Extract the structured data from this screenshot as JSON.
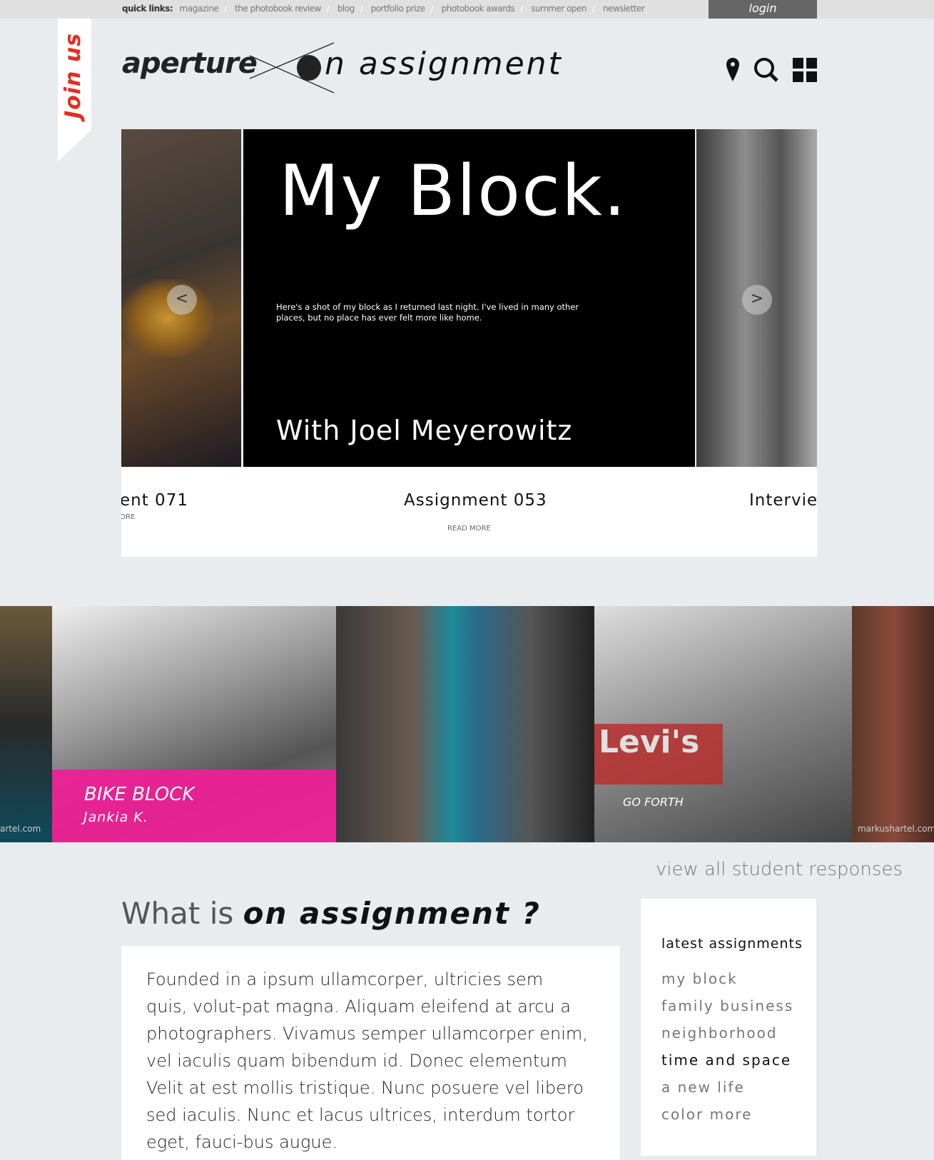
{
  "topbar": {
    "quick_links_label": "quick links:",
    "links": [
      "magazine",
      "the photobook review",
      "blog",
      "portfolio prize",
      "photobook awards",
      "summer open",
      "newsletter"
    ],
    "login": "login"
  },
  "ribbon": {
    "label": "Join us"
  },
  "logo": {
    "brand": "aperture",
    "product": "n assignment"
  },
  "header_icons": [
    "map-pin-icon",
    "search-icon",
    "grid-icon"
  ],
  "slider": {
    "title": "My Block.",
    "description": "Here's a shot of my block as I returned last night. I've lived in many other places, but no place has ever felt more like home.",
    "subtitle": "With Joel Meyerowitz",
    "prev": "<",
    "next": ">",
    "captions": [
      {
        "title": "ent 071",
        "read_more": "ORE"
      },
      {
        "title": "Assignment 053",
        "read_more": "READ MORE"
      },
      {
        "title": "Interviev"
      }
    ]
  },
  "gallery": {
    "featured_title": "BIKE BLOCK",
    "featured_author": "Jankia K.",
    "watermark_left": "artel.com",
    "watermark_right": "markushartel.com",
    "poster_text": "Levi's",
    "poster_sub": "GO FORTH",
    "accent": "#f01e96"
  },
  "view_all": "view all student responses",
  "about": {
    "heading_plain": "What is",
    "heading_bold": "on assignment ?",
    "body": "Founded in a ipsum ullamcorper, ultricies sem quis, volut-pat magna. Aliquam eleifend at arcu a photographers. Vivamus semper ullamcorper enim, vel iaculis quam bibendum id. Donec elementum Velit at est mollis tristique. Nunc posuere vel libero sed iaculis. Nunc et lacus ultrices, interdum tortor eget, fauci-bus augue."
  },
  "sidebar": {
    "heading": "latest assignments",
    "items": [
      {
        "label": "my block"
      },
      {
        "label": "family business"
      },
      {
        "label": "neighborhood"
      },
      {
        "label": "time and space",
        "active": true
      },
      {
        "label": "a new life"
      },
      {
        "label": "color more"
      }
    ]
  }
}
